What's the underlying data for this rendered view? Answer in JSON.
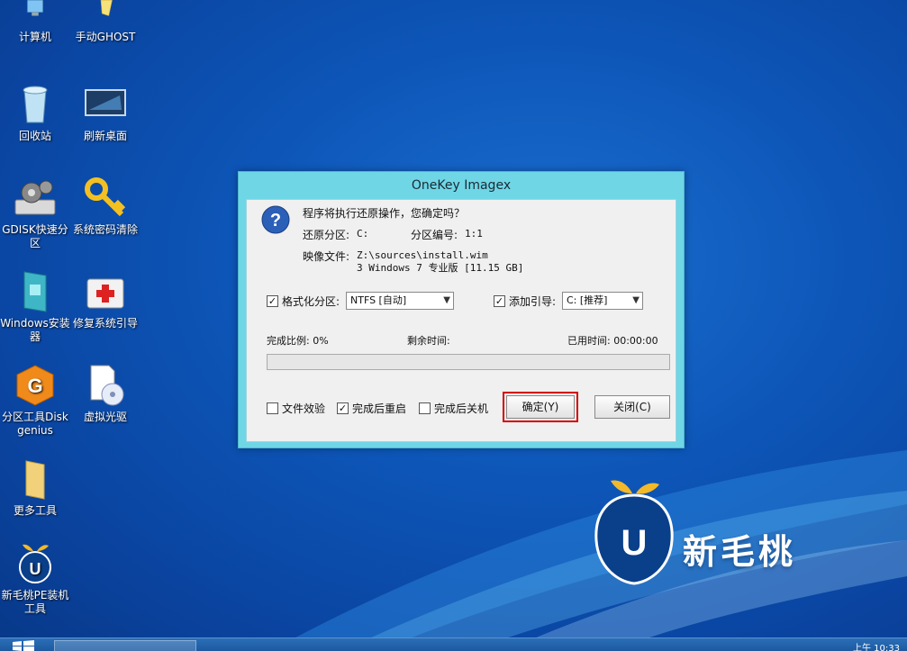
{
  "desktop": {
    "icons": [
      {
        "label": "计算机"
      },
      {
        "label": "手动GHOST"
      },
      {
        "label": "回收站"
      },
      {
        "label": "刷新桌面"
      },
      {
        "label": "GDISK快速分区"
      },
      {
        "label": "系统密码清除"
      },
      {
        "label": "Windows安装器"
      },
      {
        "label": "修复系统引导"
      },
      {
        "label": "分区工具Diskgenius"
      },
      {
        "label": "虚拟光驱"
      },
      {
        "label": "更多工具"
      },
      {
        "label": "新毛桃PE装机工具"
      }
    ]
  },
  "dialog": {
    "title": "OneKey Imagex",
    "question": "程序将执行还原操作，您确定吗？",
    "restore_partition_label": "还原分区:",
    "restore_partition_value": "C:",
    "partition_number_label": "分区编号:",
    "partition_number_value": "1:1",
    "image_file_label": "映像文件:",
    "image_file_path": "Z:\\sources\\install.wim",
    "image_file_desc": "3 Windows 7 专业版 [11.15 GB]",
    "format_checkbox_label": "格式化分区:",
    "format_checked": true,
    "format_select_value": "NTFS [自动]",
    "boot_checkbox_label": "添加引导:",
    "boot_checked": true,
    "boot_select_value": "C: [推荐]",
    "progress_label": "完成比例: 0%",
    "progress_fraction": 0,
    "remaining_label": "剩余时间:",
    "elapsed_label": "已用时间: 00:00:00",
    "verify_label": "文件效验",
    "verify_checked": false,
    "reboot_label": "完成后重启",
    "reboot_checked": true,
    "shutdown_label": "完成后关机",
    "shutdown_checked": false,
    "ok_label": "确定(Y)",
    "close_label": "关闭(C)"
  },
  "brand": {
    "text": "新毛桃"
  },
  "taskbar": {
    "clock": "上午 10:33"
  },
  "colors": {
    "dialog_title_bg": "#6fd6e6",
    "default_button_outline": "#d40000",
    "desktop_bg": "#0d56b8"
  }
}
